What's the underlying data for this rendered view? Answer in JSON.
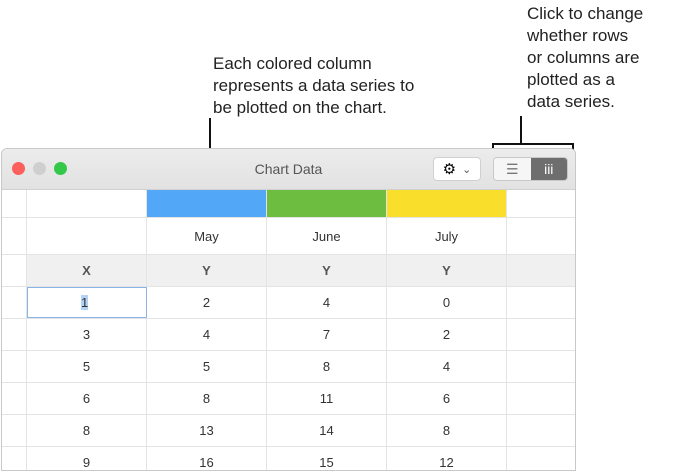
{
  "callouts": {
    "series": "Each colored column\nrepresents a data series to\nbe plotted on the chart.",
    "toggle": "Click to change\nwhether rows\nor columns are\nplotted as a\ndata series."
  },
  "window": {
    "title": "Chart Data",
    "gear_icon": "gear-icon",
    "chevron": "⌄",
    "rows_icon": "☰",
    "cols_icon": "iii"
  },
  "series_colors": [
    "#52a8f7",
    "#6dbd41",
    "#f9df2b"
  ],
  "series_names": [
    "May",
    "June",
    "July"
  ],
  "headers": [
    "X",
    "Y",
    "Y",
    "Y"
  ],
  "rows": [
    [
      "1",
      "2",
      "4",
      "0"
    ],
    [
      "3",
      "4",
      "7",
      "2"
    ],
    [
      "5",
      "5",
      "8",
      "4"
    ],
    [
      "6",
      "8",
      "11",
      "6"
    ],
    [
      "8",
      "13",
      "14",
      "8"
    ],
    [
      "9",
      "16",
      "15",
      "12"
    ]
  ]
}
